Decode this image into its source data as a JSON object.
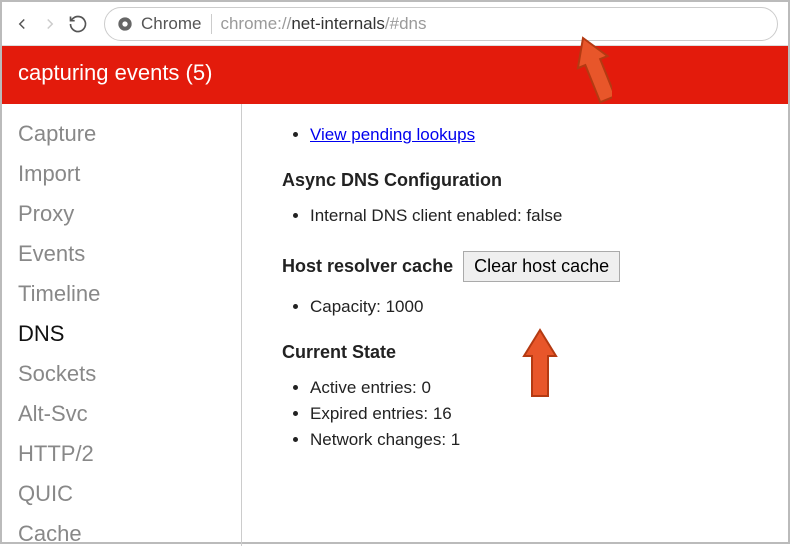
{
  "toolbar": {
    "label": "Chrome",
    "url_dim_pre": "chrome://",
    "url_hl": "net-internals",
    "url_dim_post": "/#dns"
  },
  "banner": {
    "text": "capturing events (5)"
  },
  "sidebar": {
    "items": [
      {
        "label": "Capture"
      },
      {
        "label": "Import"
      },
      {
        "label": "Proxy"
      },
      {
        "label": "Events"
      },
      {
        "label": "Timeline"
      },
      {
        "label": "DNS"
      },
      {
        "label": "Sockets"
      },
      {
        "label": "Alt-Svc"
      },
      {
        "label": "HTTP/2"
      },
      {
        "label": "QUIC"
      },
      {
        "label": "Cache"
      }
    ],
    "active_index": 5
  },
  "main": {
    "pending_link": "View pending lookups",
    "async_title": "Async DNS Configuration",
    "async_item": "Internal DNS client enabled: false",
    "host_cache_label": "Host resolver cache",
    "clear_button": "Clear host cache",
    "capacity_item": "Capacity: 1000",
    "current_state_title": "Current State",
    "state_items": [
      "Active entries: 0",
      "Expired entries: 16",
      "Network changes: 1"
    ]
  }
}
